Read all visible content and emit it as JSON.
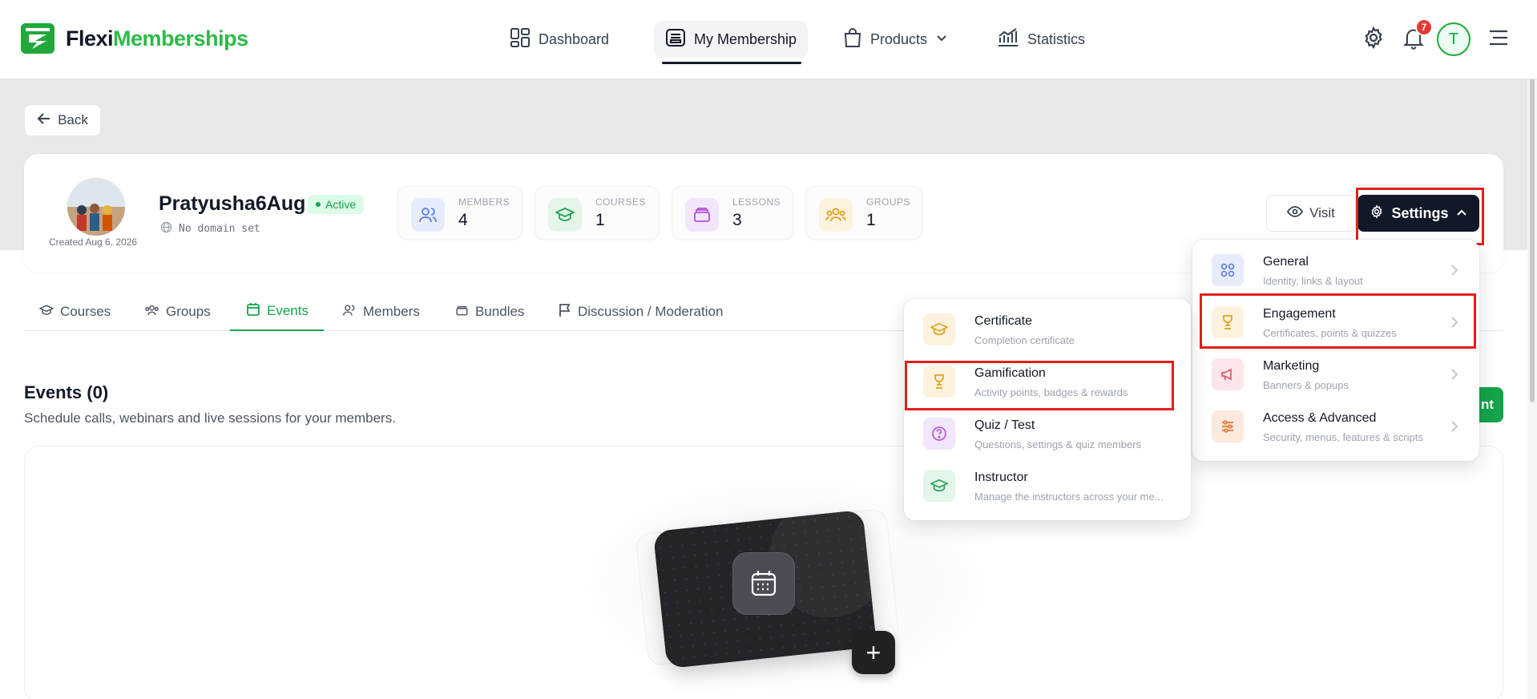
{
  "brand": {
    "name_part1": "Flexi",
    "name_part2": "Memberships"
  },
  "nav": {
    "dashboard": "Dashboard",
    "my_membership": "My Membership",
    "products": "Products",
    "statistics": "Statistics"
  },
  "topbar": {
    "notification_count": "7",
    "user_initial": "T"
  },
  "back_label": "Back",
  "membership": {
    "created": "Created Aug 6, 2026",
    "name": "Pratyusha6Aug",
    "status": "Active",
    "domain": "No domain set"
  },
  "stats": [
    {
      "label": "MEMBERS",
      "value": "4"
    },
    {
      "label": "COURSES",
      "value": "1"
    },
    {
      "label": "LESSONS",
      "value": "3"
    },
    {
      "label": "GROUPS",
      "value": "1"
    }
  ],
  "actions": {
    "visit": "Visit",
    "settings": "Settings"
  },
  "tabs": [
    "Courses",
    "Groups",
    "Events",
    "Members",
    "Bundles",
    "Discussion / Moderation"
  ],
  "events_section": {
    "title": "Events (0)",
    "subtitle": "Schedule calls, webinars and live sessions for your members.",
    "partial_button": "nt"
  },
  "settings_menu": [
    {
      "title": "General",
      "subtitle": "Identity, links & layout",
      "icon": "grid-icon"
    },
    {
      "title": "Engagement",
      "subtitle": "Certificates, points & quizzes",
      "icon": "trophy-icon"
    },
    {
      "title": "Marketing",
      "subtitle": "Banners & popups",
      "icon": "megaphone-icon"
    },
    {
      "title": "Access & Advanced",
      "subtitle": "Security, menus, features & scripts",
      "icon": "sliders-icon"
    }
  ],
  "engagement_submenu": [
    {
      "title": "Certificate",
      "subtitle": "Completion certificate",
      "icon": "mortarboard-icon"
    },
    {
      "title": "Gamification",
      "subtitle": "Activity points, badges & rewards",
      "icon": "trophy-icon"
    },
    {
      "title": "Quiz / Test",
      "subtitle": "Questions, settings & quiz members",
      "icon": "question-icon"
    },
    {
      "title": "Instructor",
      "subtitle": "Manage the instructors across your me...",
      "icon": "mortarboard-icon"
    }
  ],
  "colors": {
    "brand_green": "#2fba49",
    "dark": "#111827",
    "highlight_red": "#e0201d"
  }
}
